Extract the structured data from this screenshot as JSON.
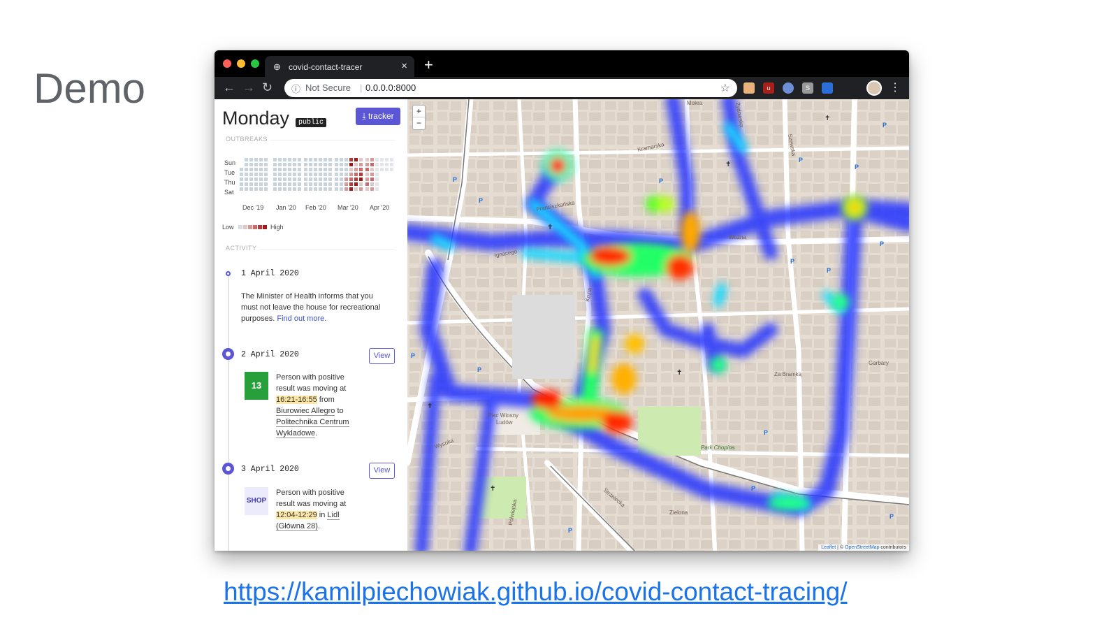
{
  "slide": {
    "title": "Demo",
    "link": "https://kamilpiechowiak.github.io/covid-contact-tracing/"
  },
  "browser": {
    "tab_title": "covid-contact-tracer",
    "tab_close": "×",
    "new_tab": "+",
    "security_label": "Not Secure",
    "url": "0.0.0.0:8000"
  },
  "sidebar": {
    "day_title": "Monday",
    "badge": "public",
    "tracker_button": "tracker",
    "outbreaks_label": "OUTBREAKS",
    "day_labels": [
      "Sun",
      "Tue",
      "Thu",
      "Sat"
    ],
    "month_labels": [
      "Dec '19",
      "Jan '20",
      "Feb '20",
      "Mar '20",
      "Apr '20"
    ],
    "legend_low": "Low",
    "legend_high": "High",
    "legend_colors": [
      "#e0c8c8",
      "#d49a9a",
      "#c96a6a",
      "#b33b3b",
      "#9c1c1c"
    ],
    "activity_label": "ACTIVITY",
    "entries": [
      {
        "date": "1 April 2020",
        "text": "The Minister of Health informs that you must not leave the house for recreational purposes.",
        "link": "Find out more."
      },
      {
        "date": "2 April 2020",
        "view": "View",
        "badge": "13",
        "t1": "Person with positive result was moving at",
        "time": "16:21-16:55",
        "from_word": "from",
        "from": "Biurowiec Allegro",
        "to_word": "to",
        "to": "Politechnika Centrum Wykladowe",
        "end": "."
      },
      {
        "date": "3 April 2020",
        "view": "View",
        "badge": "SHOP",
        "t1": "Person with positive result was moving at",
        "time": "12:04-12:29",
        "in_word": "in",
        "place": "Lidl (Główna 28)",
        "end": "."
      }
    ]
  },
  "map": {
    "zoom_in": "+",
    "zoom_out": "−",
    "attribution_leaflet": "Leaflet",
    "attribution_mid": " | © ",
    "attribution_osm": "OpenStreetMap",
    "attribution_end": " contributors",
    "street_labels": [
      "Mokra",
      "Kramarska",
      "Ignacego",
      "Kozia",
      "Wożna",
      "Garbary",
      "Zielona",
      "Zza Bramką",
      "Plac Wiosny Ludów",
      "Park Chopina",
      "Półwiejska",
      "Wysoka",
      "Strzelecka",
      "Żydowska",
      "Szewska",
      "Franciszkańska"
    ]
  },
  "colors": {
    "accent": "#5a56d6",
    "green_badge": "#27a03b",
    "link": "#1a73e8"
  }
}
